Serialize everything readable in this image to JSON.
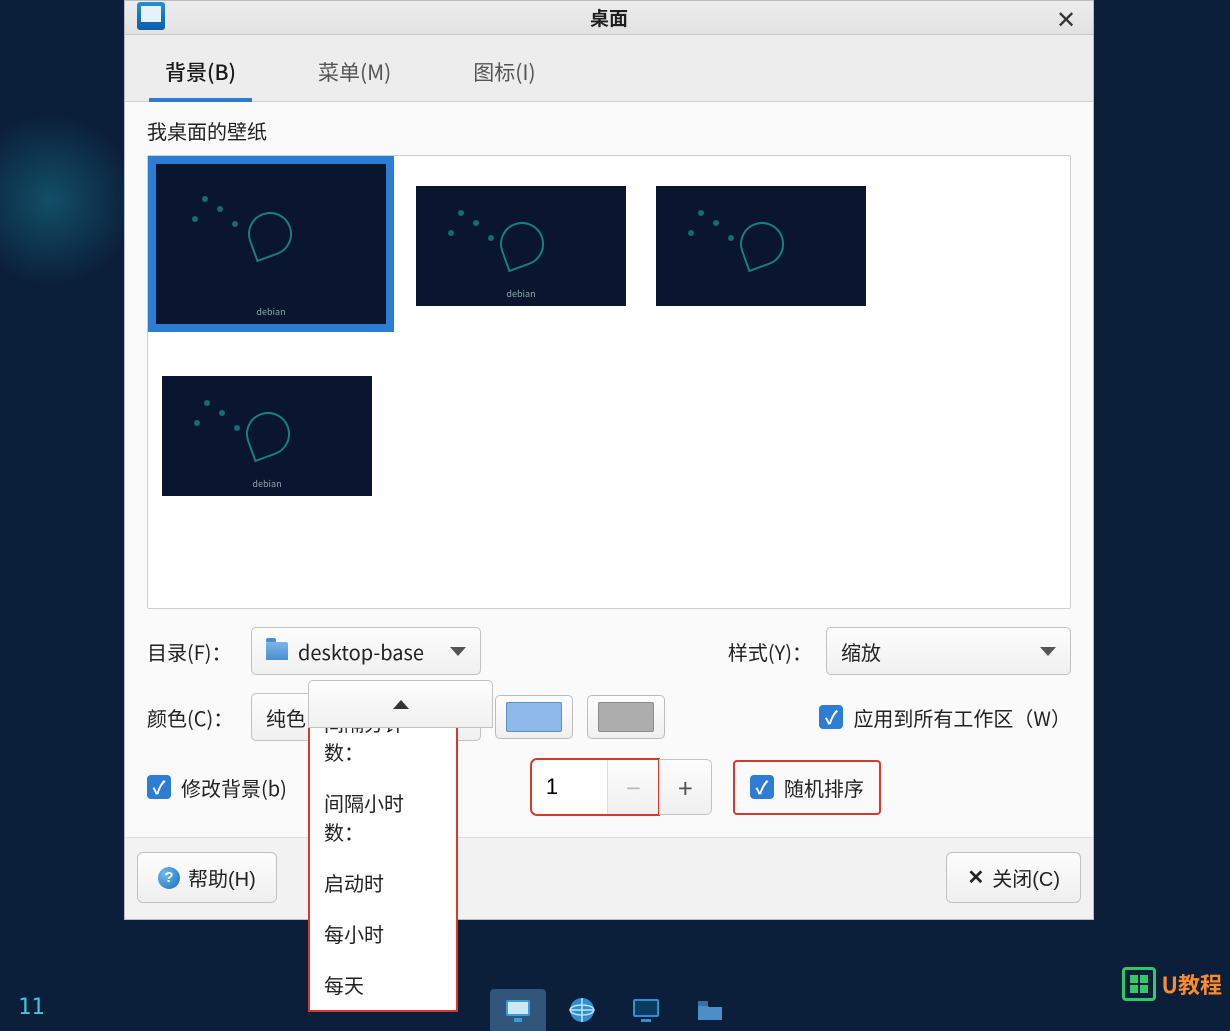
{
  "titlebar": {
    "title": "桌面"
  },
  "tabs": {
    "background": "背景(B)",
    "menu": "菜单(M)",
    "icon": "图标(I)"
  },
  "section": {
    "wallpaper_label": "我桌面的壁纸"
  },
  "wallpapers": {
    "caption": "debian"
  },
  "dir": {
    "label": "目录(F)：",
    "value": "desktop-base"
  },
  "style": {
    "label": "样式(Y)：",
    "value": "缩放"
  },
  "color": {
    "label": "颜色(C)：",
    "value": "纯色"
  },
  "apply_all": {
    "label": "应用到所有工作区（W）"
  },
  "change_bg": {
    "label": "修改背景(b)"
  },
  "spinner": {
    "value": "1"
  },
  "random": {
    "label": "随机排序"
  },
  "dropdown": {
    "items": [
      "间隔分钟数：",
      "间隔小时数：",
      "启动时",
      "每小时",
      "每天"
    ]
  },
  "footer": {
    "help": "帮助(H)",
    "close": "关闭(C)"
  },
  "taskbar": {
    "clock": "11"
  },
  "watermark": {
    "text": "U教程"
  }
}
